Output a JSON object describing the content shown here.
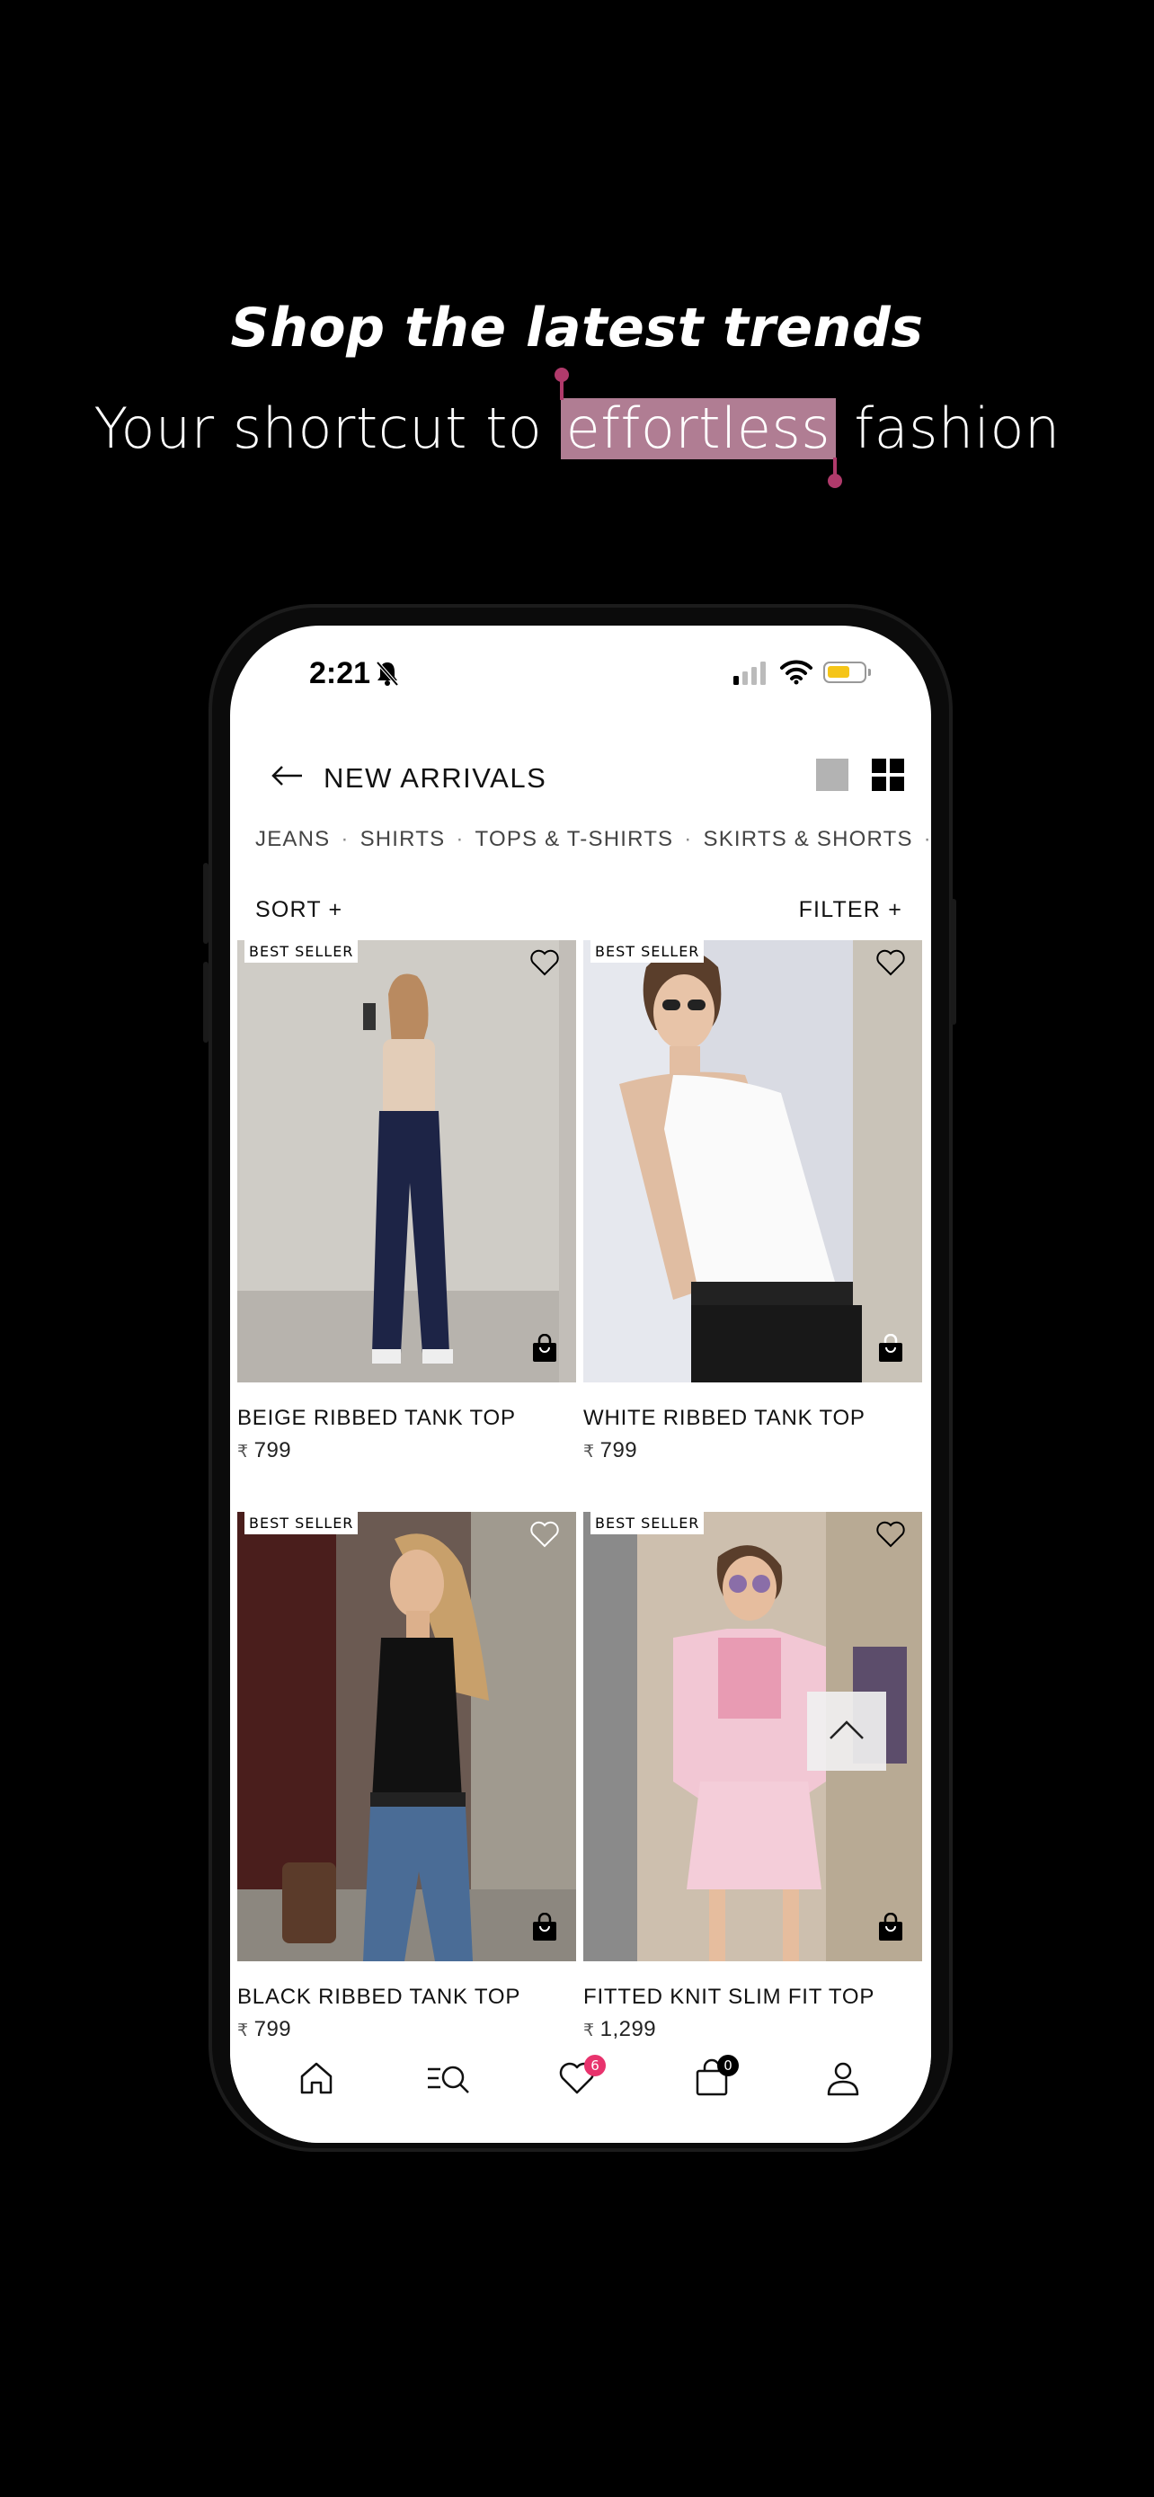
{
  "promo": {
    "headline": "Shop the latest trends",
    "subline_before": "Your shortcut to",
    "subline_highlight": "effortless",
    "subline_after": "fashion"
  },
  "status_bar": {
    "time": "2:21"
  },
  "header": {
    "title": "NEW ARRIVALS"
  },
  "categories": [
    "JEANS",
    "SHIRTS",
    "TOPS & T-SHIRTS",
    "SKIRTS & SHORTS"
  ],
  "toolbar": {
    "sort_label": "SORT +",
    "filter_label": "FILTER +"
  },
  "products": [
    {
      "name": "BEIGE RIBBED TANK TOP",
      "currency": "₹",
      "price": "799",
      "badge": "BEST SELLER"
    },
    {
      "name": "WHITE RIBBED TANK TOP",
      "currency": "₹",
      "price": "799",
      "badge": "BEST SELLER"
    },
    {
      "name": "BLACK RIBBED TANK TOP",
      "currency": "₹",
      "price": "799",
      "badge": "BEST SELLER"
    },
    {
      "name": "FITTED KNIT SLIM FIT TOP",
      "currency": "₹",
      "price": "1,299",
      "badge": "BEST SELLER"
    }
  ],
  "nav": {
    "wishlist_count": "6",
    "cart_count": "0"
  },
  "colors": {
    "highlight": "#b07d93",
    "handle": "#b03a6b",
    "wishlist_badge": "#e8336d",
    "cart_badge": "#000000"
  }
}
